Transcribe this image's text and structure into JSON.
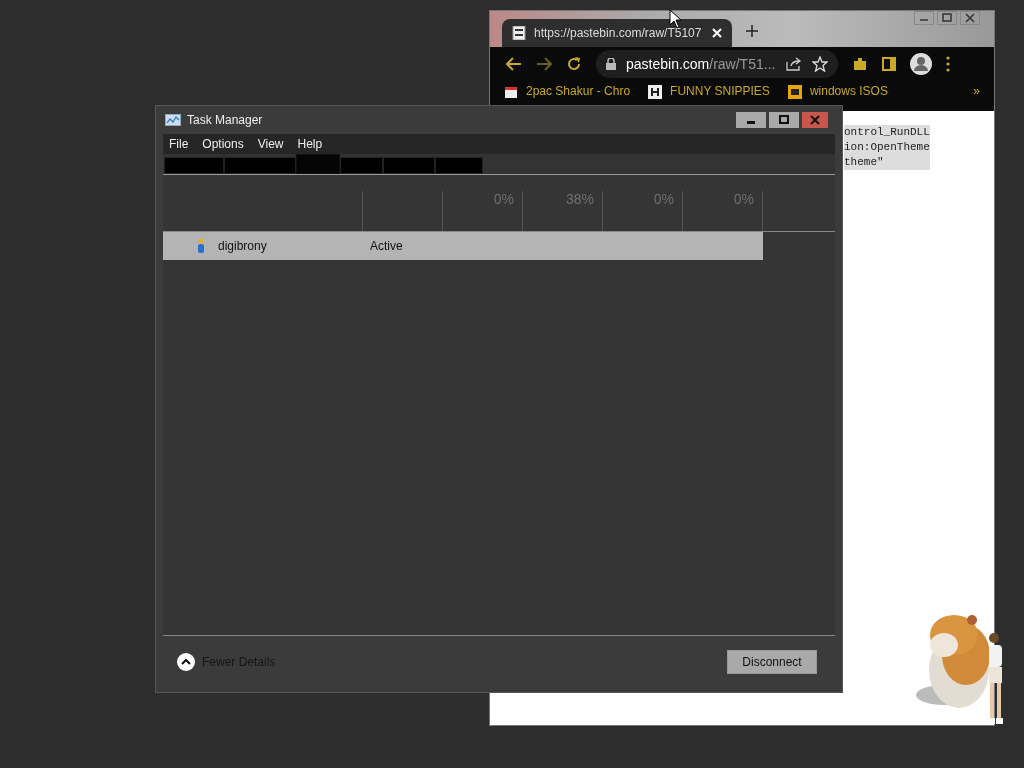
{
  "browser": {
    "tab": {
      "title": "https://pastebin.com/raw/T5107",
      "selected": true
    },
    "address": {
      "host": "pastebin.com",
      "path": "/raw/T51..."
    },
    "bookmarks": [
      {
        "label": "2pac Shakur - Chro"
      },
      {
        "label": "FUNNY SNIPPIES"
      },
      {
        "label": "windows ISOS"
      }
    ],
    "bookmarks_overflow": "»",
    "code_lines": [
      "ontrol_RunDLL",
      "ion:OpenTheme",
      "theme\""
    ]
  },
  "task_manager": {
    "title": "Task Manager",
    "menu": [
      "File",
      "Options",
      "View",
      "Help"
    ],
    "tabs": [
      {
        "selected": false
      },
      {
        "selected": false
      },
      {
        "selected": true
      },
      {
        "selected": false
      },
      {
        "selected": false
      },
      {
        "selected": false
      }
    ],
    "columns": [
      {
        "kind": "text"
      },
      {
        "kind": "text"
      },
      {
        "kind": "metric",
        "usage": "0%"
      },
      {
        "kind": "metric",
        "usage": "38%"
      },
      {
        "kind": "metric",
        "usage": "0%"
      },
      {
        "kind": "metric",
        "usage": "0%"
      }
    ],
    "rows": [
      {
        "user": "digibrony",
        "status": "Active",
        "selected": true
      }
    ],
    "fewer_details": "Fewer Details",
    "button": "Disconnect"
  }
}
